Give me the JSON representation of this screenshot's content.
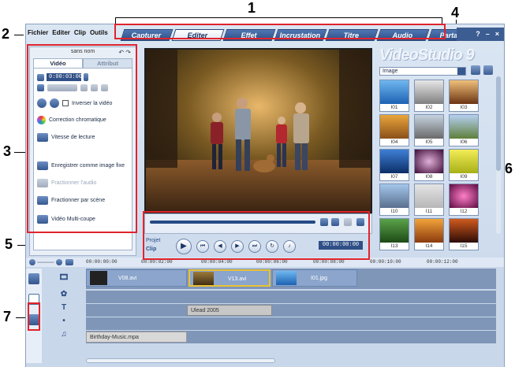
{
  "menu": {
    "items": [
      "Fichier",
      "Editer",
      "Clip",
      "Outils"
    ]
  },
  "tabs": [
    "Capturer",
    "Editer",
    "Effet",
    "Incrustation",
    "Titre",
    "Audio",
    "Partager"
  ],
  "window_controls": [
    "?",
    "–",
    "×"
  ],
  "brand": "VideoStudio 9",
  "options_panel": {
    "title": "sans nom",
    "subtabs": [
      "Vidéo",
      "Attribut"
    ],
    "timecode": "0:00:03:00",
    "reverse_video": "Inverser la vidéo",
    "items": [
      "Correction chromatique",
      "Vitesse de lecture",
      "Enregistrer comme image fixe",
      "Fractionner l'audio",
      "Fractionner par scène",
      "Vidéo Multi-coupe"
    ]
  },
  "player": {
    "mode_project": "Projet",
    "mode_clip": "Clip",
    "timecode": "00:00:00:00"
  },
  "library": {
    "category": "Image",
    "thumbs": [
      "I01",
      "I02",
      "I03",
      "I04",
      "I05",
      "I06",
      "I07",
      "I08",
      "I09",
      "I10",
      "I11",
      "I12",
      "I13",
      "I14",
      "I15"
    ]
  },
  "timeline": {
    "ruler": [
      "00:00:00:00",
      "00:00:02:00",
      "00:00:04:00",
      "00:00:06:00",
      "00:00:08:00",
      "00:00:10:00",
      "00:00:12:00"
    ],
    "video_clips": [
      "V08.avi",
      "V13.avi",
      "I01.jpg"
    ],
    "title_clip": "Ulead 2005",
    "music_clip": "Birthday-Music.mpa"
  },
  "callouts": [
    "1",
    "2",
    "3",
    "4",
    "5",
    "6",
    "7"
  ],
  "colors": {
    "accent": "#2d4f86",
    "highlight": "#e0242c"
  }
}
